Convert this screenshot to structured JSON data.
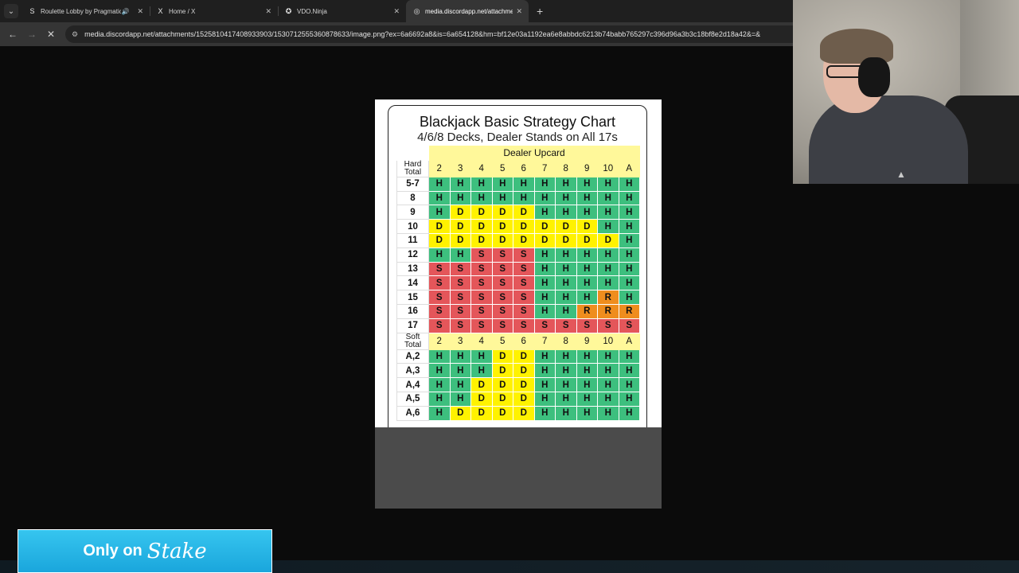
{
  "tabs": [
    {
      "title": "Roulette Lobby by Pragmatic",
      "icon": "S",
      "audio": true,
      "active": false
    },
    {
      "title": "Home / X",
      "icon": "X",
      "audio": false,
      "active": false
    },
    {
      "title": "VDO.Ninja",
      "icon": "✪",
      "audio": false,
      "active": false
    },
    {
      "title": "media.discordapp.net/attachments",
      "icon": "◎",
      "audio": false,
      "active": true
    }
  ],
  "toolbar": {
    "url": "media.discordapp.net/attachments/1525810417408933903/1530712555360878633/image.png?ex=6a6692a8&is=6a654128&hm=bf12e03a1192ea6e8abbdc6213b74babb765297c396d96a3b3c18bf8e2d18a42&=&"
  },
  "chart": {
    "title": "Blackjack Basic Strategy Chart",
    "subtitle": "4/6/8 Decks, Dealer Stands on All 17s",
    "dealer_header": "Dealer Upcard",
    "hard_label_1": "Hard",
    "hard_label_2": "Total",
    "soft_label_1": "Soft",
    "soft_label_2": "Total",
    "upcards": [
      "2",
      "3",
      "4",
      "5",
      "6",
      "7",
      "8",
      "9",
      "10",
      "A"
    ],
    "hard_rows": [
      {
        "label": "5-7",
        "cells": [
          "H",
          "H",
          "H",
          "H",
          "H",
          "H",
          "H",
          "H",
          "H",
          "H"
        ]
      },
      {
        "label": "8",
        "cells": [
          "H",
          "H",
          "H",
          "H",
          "H",
          "H",
          "H",
          "H",
          "H",
          "H"
        ]
      },
      {
        "label": "9",
        "cells": [
          "H",
          "D",
          "D",
          "D",
          "D",
          "H",
          "H",
          "H",
          "H",
          "H"
        ]
      },
      {
        "label": "10",
        "cells": [
          "D",
          "D",
          "D",
          "D",
          "D",
          "D",
          "D",
          "D",
          "H",
          "H"
        ]
      },
      {
        "label": "11",
        "cells": [
          "D",
          "D",
          "D",
          "D",
          "D",
          "D",
          "D",
          "D",
          "D",
          "H"
        ]
      },
      {
        "label": "12",
        "cells": [
          "H",
          "H",
          "S",
          "S",
          "S",
          "H",
          "H",
          "H",
          "H",
          "H"
        ]
      },
      {
        "label": "13",
        "cells": [
          "S",
          "S",
          "S",
          "S",
          "S",
          "H",
          "H",
          "H",
          "H",
          "H"
        ]
      },
      {
        "label": "14",
        "cells": [
          "S",
          "S",
          "S",
          "S",
          "S",
          "H",
          "H",
          "H",
          "H",
          "H"
        ]
      },
      {
        "label": "15",
        "cells": [
          "S",
          "S",
          "S",
          "S",
          "S",
          "H",
          "H",
          "H",
          "R",
          "H"
        ]
      },
      {
        "label": "16",
        "cells": [
          "S",
          "S",
          "S",
          "S",
          "S",
          "H",
          "H",
          "R",
          "R",
          "R"
        ]
      },
      {
        "label": "17",
        "cells": [
          "S",
          "S",
          "S",
          "S",
          "S",
          "S",
          "S",
          "S",
          "S",
          "S"
        ]
      }
    ],
    "soft_rows": [
      {
        "label": "A,2",
        "cells": [
          "H",
          "H",
          "H",
          "D",
          "D",
          "H",
          "H",
          "H",
          "H",
          "H"
        ]
      },
      {
        "label": "A,3",
        "cells": [
          "H",
          "H",
          "H",
          "D",
          "D",
          "H",
          "H",
          "H",
          "H",
          "H"
        ]
      },
      {
        "label": "A,4",
        "cells": [
          "H",
          "H",
          "D",
          "D",
          "D",
          "H",
          "H",
          "H",
          "H",
          "H"
        ]
      },
      {
        "label": "A,5",
        "cells": [
          "H",
          "H",
          "D",
          "D",
          "D",
          "H",
          "H",
          "H",
          "H",
          "H"
        ]
      },
      {
        "label": "A,6",
        "cells": [
          "H",
          "D",
          "D",
          "D",
          "D",
          "H",
          "H",
          "H",
          "H",
          "H"
        ]
      }
    ],
    "colors": {
      "H": "#3dbf7e",
      "S": "#e4565a",
      "D": "#fff200",
      "R": "#ef8d1e",
      "header": "#fff89a"
    }
  },
  "banner": {
    "text": "Only on",
    "brand": "Stake"
  },
  "icons": {
    "tab_menu": "chevron-down-icon",
    "audio": "speaker-icon",
    "close": "close-icon",
    "new_tab": "plus-icon",
    "back": "back-arrow-icon",
    "forward": "forward-arrow-icon",
    "stop": "close-icon",
    "site_info": "site-info-icon"
  }
}
